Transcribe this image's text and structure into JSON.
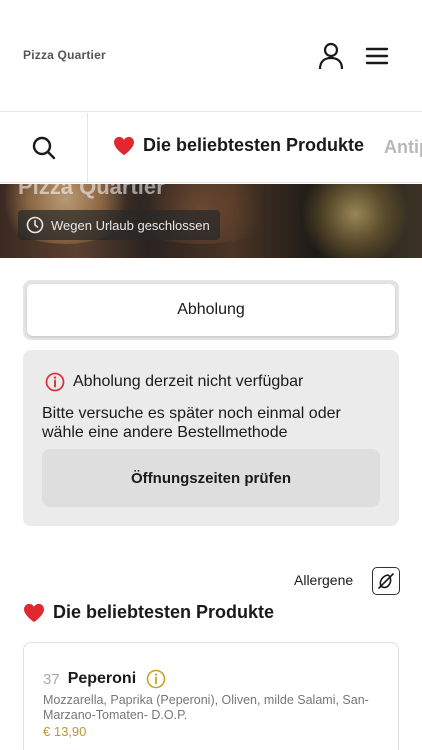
{
  "header": {
    "brand": "Pizza Quartier",
    "user_icon": "user-icon",
    "menu_icon": "hamburger-menu-icon"
  },
  "categories": {
    "search_icon": "search-icon",
    "active": "Die beliebtesten Produkte",
    "next": "Antip"
  },
  "hero": {
    "title": "Pizza Quartier",
    "closed_badge": "Wegen Urlaub geschlossen"
  },
  "order": {
    "method": "Abholung",
    "notice_title": "Abholung derzeit nicht verfügbar",
    "notice_text": "Bitte versuche es später noch einmal oder wähle eine andere Bestellmethode",
    "hours_button": "Öffnungszeiten prüfen"
  },
  "allergens": {
    "label": "Allergene"
  },
  "section": {
    "title": "Die beliebtesten Produkte"
  },
  "products": [
    {
      "number": "37",
      "name": "Peperoni",
      "description": "Mozzarella, Paprika (Peperoni), Oliven, milde Salami, San-Marzano-Tomaten- D.O.P.",
      "price": "€ 13,90"
    }
  ],
  "colors": {
    "heart": "#e0282e",
    "notice_icon": "#d9363e",
    "price": "#b8973a",
    "info_icon": "#c9a227"
  }
}
